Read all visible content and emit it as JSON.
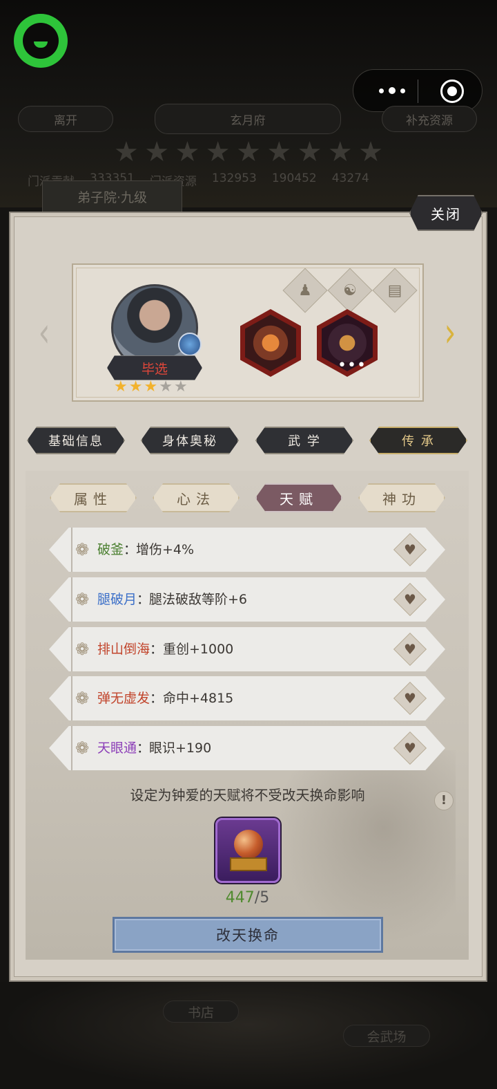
{
  "background": {
    "top_buttons": [
      "离开",
      "玄月府",
      "补充资源"
    ],
    "stats": [
      "门派贡献",
      "333351",
      "门派资源",
      "132953",
      "190452",
      "43274"
    ],
    "badge": "弟子院·九级",
    "bottom_labels": [
      "书店",
      "会武场"
    ]
  },
  "panel": {
    "close_label": "关闭"
  },
  "hero": {
    "name": "毕选",
    "stars_filled": 3,
    "stars_total": 5,
    "name_color": "#e0473a"
  },
  "main_tabs": [
    {
      "label": "基础信息",
      "active": false
    },
    {
      "label": "身体奥秘",
      "active": false
    },
    {
      "label": "武 学",
      "active": false
    },
    {
      "label": "传 承",
      "active": true
    }
  ],
  "sub_tabs": [
    {
      "label": "属性",
      "active": false
    },
    {
      "label": "心法",
      "active": false
    },
    {
      "label": "天赋",
      "active": true
    },
    {
      "label": "神功",
      "active": false
    }
  ],
  "talents": [
    {
      "name": "破釜",
      "sep": "：",
      "effect": "增伤+4%",
      "color": "#4a7f2f"
    },
    {
      "name": "腿破月",
      "sep": "：",
      "effect": "腿法破敌等阶+6",
      "color": "#3b6fc8"
    },
    {
      "name": "排山倒海",
      "sep": "：",
      "effect": "重创+1000",
      "color": "#c1442b"
    },
    {
      "name": "弹无虚发",
      "sep": "：",
      "effect": "命中+4815",
      "color": "#c1442b"
    },
    {
      "name": "天眼通",
      "sep": "：",
      "effect": "眼识+190",
      "color": "#8c3fb8"
    }
  ],
  "hint": "设定为钟爱的天赋将不受改天换命影响",
  "item": {
    "have": "447",
    "need": "/5"
  },
  "action_label": "改天换命",
  "icons": {
    "arrow_left": "‹",
    "arrow_right": "›",
    "figure": "♟",
    "yin_yang": "☯",
    "book": "▤",
    "gear": "❁",
    "heart": "♥",
    "info": "!",
    "star": "★"
  },
  "colors": {
    "accent_green": "#2ec43a",
    "button_blue": "#8aa3c5",
    "active_tab": "#7b5a63"
  }
}
